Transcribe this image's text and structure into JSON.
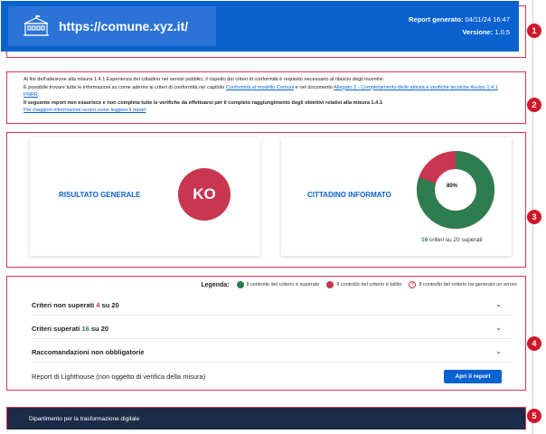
{
  "header": {
    "site": "https://comune.xyz.it/",
    "report_label": "Report generato:",
    "report_date": "04/11/24 16:47",
    "version_label": "Versione:",
    "version": "1.0.5",
    "icon": "town-hall-icon"
  },
  "intro": {
    "line1": "Ai fini dell'adesione alla misura 1.4.1 Esperienza del cittadino nei servizi pubblici, il rispetto dei criteri di conformità è requisito necessario al rilascio degli incentivi.",
    "line2_pre": "È possibile trovare tutte le informazioni su come aderire ai criteri di conformità nel capitolo ",
    "line2_link1": "Conformità al modello Comuni",
    "line2_mid": " e nel documento ",
    "line2_link2": "Allegato 2 - Completamento delle attività e verifiche tecniche Avviso 1.4.1 PNRR",
    "line2_tail": ".",
    "line3": "Il seguente report non esaurisce e non completa tutte le verifiche da effettuarsi per il completo raggiungimento degli obiettivi relativi alla misura 1.4.1",
    "link_more": "Per maggiori informazioni scopri come leggere il report"
  },
  "cards": {
    "general_title": "RISULTATO GENERALE",
    "general_result": "KO",
    "citizen_title": "CITTADINO INFORMATO",
    "donut_percent": "80%",
    "donut_fraction": 0.8,
    "passed_count": "16",
    "passed_suffix": " criteri su 20 superati"
  },
  "legend": {
    "title": "Legenda:",
    "passed": "Il controllo del criterio è superato",
    "failed": "Il controllo del criterio è fallito",
    "error": "Il controllo del criterio ha generato un errore"
  },
  "rows": {
    "not_passed_label": "Criteri non superati ",
    "not_passed_num": "4",
    "not_passed_tail": " su 20",
    "passed_label": "Criteri superati ",
    "passed_num": "16",
    "passed_tail": " su 20",
    "recommendations": "Raccomandazioni non obbligatorie",
    "lighthouse": "Report di Lighthouse (non oggetto di verifica della misura)",
    "open_report": "Apri il report"
  },
  "footer": {
    "text": "Dipartimento per la trasformazione digitale"
  },
  "badges": [
    "1",
    "2",
    "3",
    "4",
    "5"
  ],
  "colors": {
    "primary": "#0a62d0",
    "success": "#2e7d4f",
    "danger": "#c9364f",
    "footer": "#1a2c48"
  }
}
